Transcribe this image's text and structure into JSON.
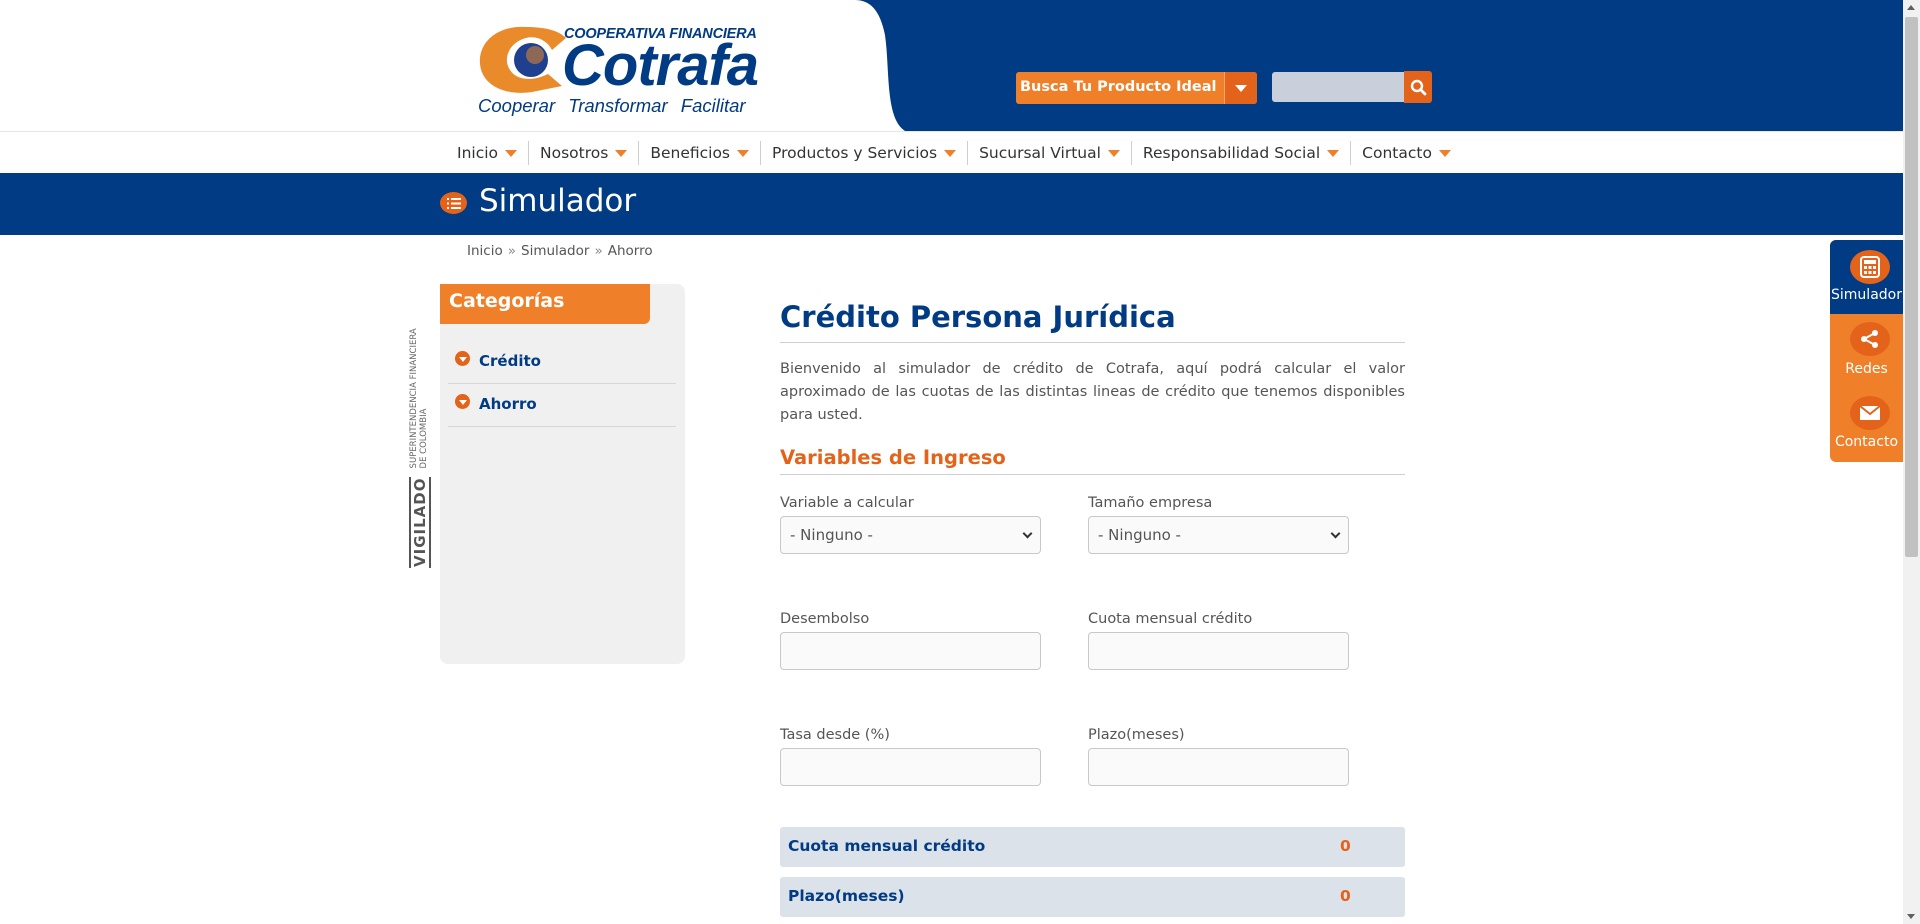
{
  "brand": {
    "top_line": "COOPERATIVA FINANCIERA",
    "name": "Cotrafa",
    "tagline": "Cooperar  Transformar  Facilitar",
    "primary_color": "#003b83",
    "accent_color": "#f07f2a"
  },
  "header": {
    "product_finder_label": "Busca Tu Producto Ideal",
    "search_placeholder": ""
  },
  "nav": {
    "items": [
      {
        "label": "Inicio"
      },
      {
        "label": "Nosotros"
      },
      {
        "label": "Beneficios"
      },
      {
        "label": "Productos y Servicios"
      },
      {
        "label": "Sucursal Virtual"
      },
      {
        "label": "Responsabilidad Social"
      },
      {
        "label": "Contacto"
      }
    ]
  },
  "page": {
    "title": "Simulador",
    "breadcrumb": [
      "Inicio",
      "Simulador",
      "Ahorro"
    ]
  },
  "vigilado": {
    "word": "VIGILADO",
    "line1": "SUPERINTENDENCIA FINANCIERA",
    "line2": "DE COLOMBIA"
  },
  "sidebar": {
    "heading": "Categorías",
    "items": [
      {
        "label": "Crédito"
      },
      {
        "label": "Ahorro"
      }
    ]
  },
  "main": {
    "heading": "Crédito Persona Jurídica",
    "intro": "Bienvenido al simulador de crédito de Cotrafa, aquí podrá calcular el valor aproximado de las cuotas de las distintas lineas de crédito que tenemos disponibles para usted.",
    "section_heading": "Variables de Ingreso",
    "fields": {
      "variable": {
        "label": "Variable a calcular",
        "value": "- Ninguno -"
      },
      "tamano": {
        "label": "Tamaño empresa",
        "value": "- Ninguno -"
      },
      "desembolso": {
        "label": "Desembolso",
        "value": ""
      },
      "cuota": {
        "label": "Cuota mensual crédito",
        "value": ""
      },
      "tasa": {
        "label": "Tasa desde (%)",
        "value": ""
      },
      "plazo": {
        "label": "Plazo(meses)",
        "value": ""
      }
    },
    "results": [
      {
        "label": "Cuota mensual crédito",
        "value": "0"
      },
      {
        "label": "Plazo(meses)",
        "value": "0"
      }
    ]
  },
  "float_menu": {
    "items": [
      {
        "label": "Simulador",
        "icon": "calculator-icon"
      },
      {
        "label": "Redes",
        "icon": "share-icon"
      },
      {
        "label": "Contacto",
        "icon": "mail-icon"
      }
    ]
  }
}
